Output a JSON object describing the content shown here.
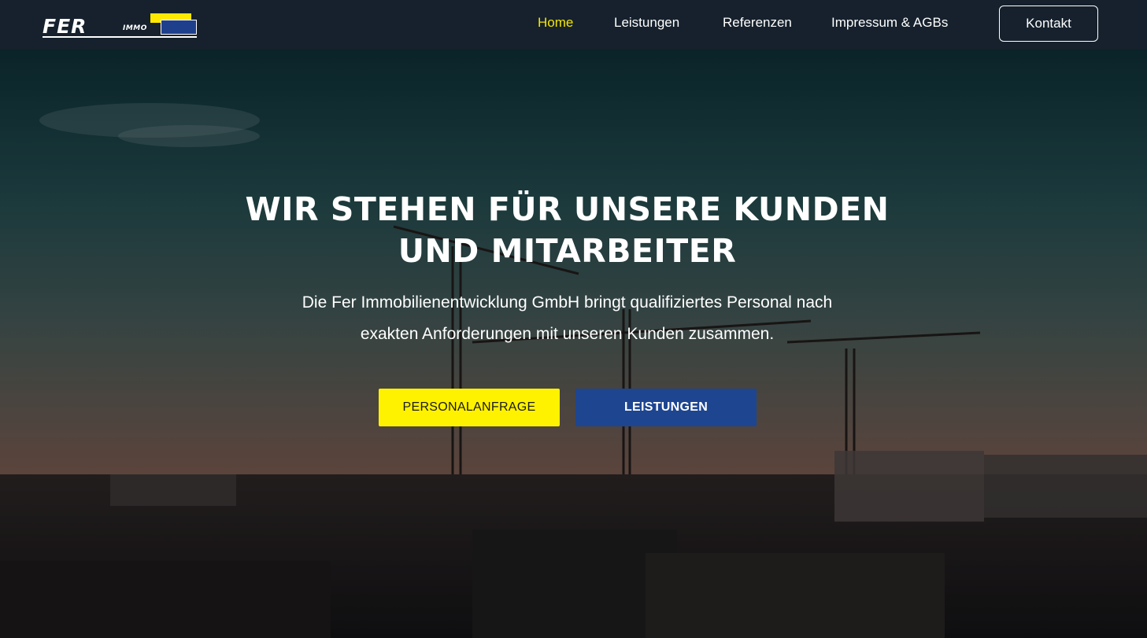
{
  "header": {
    "logo_text": "FER",
    "logo_subtext": "IMMO",
    "nav": [
      {
        "label": "Home",
        "active": true
      },
      {
        "label": "Leistungen",
        "active": false
      },
      {
        "label": "Referenzen",
        "active": false
      },
      {
        "label": "Impressum & AGBs",
        "active": false
      }
    ],
    "contact_label": "Kontakt"
  },
  "hero": {
    "title_line1": "WIR STEHEN FÜR UNSERE KUNDEN",
    "title_line2": "UND MITARBEITER",
    "subtitle_line1": "Die Fer Immobilienentwicklung GmbH bringt qualifiziertes Personal nach",
    "subtitle_line2": "exakten Anforderungen mit unseren Kunden zusammen.",
    "primary_button": "PERSONALANFRAGE",
    "secondary_button": "LEISTUNGEN",
    "background": "construction-site-cranes-dusk"
  },
  "colors": {
    "header_bg": "#16212d",
    "nav_active": "#f5e500",
    "primary_button_bg": "#fff200",
    "secondary_button_bg": "#1e4590",
    "logo_blue": "#1e3f8c",
    "logo_yellow": "#ffe800"
  }
}
